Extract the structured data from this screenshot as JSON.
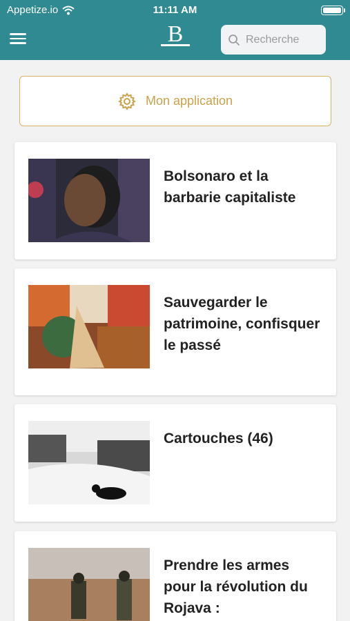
{
  "status_bar": {
    "carrier": "Appetize.io",
    "time": "11:11 AM"
  },
  "header": {
    "logo_letter": "B",
    "search_placeholder": "Recherche"
  },
  "app_button": {
    "label": "Mon application"
  },
  "articles": [
    {
      "title": "Bolsonaro et la barbarie capitaliste"
    },
    {
      "title": "Sauvegarder le patrimoine, confisquer le passé"
    },
    {
      "title": "Cartouches (46)"
    },
    {
      "title": "Prendre les armes pour la révolution du Rojava :"
    }
  ],
  "colors": {
    "teal": "#2f8a91",
    "gold": "#c9a24a",
    "background": "#f2f2f2"
  }
}
